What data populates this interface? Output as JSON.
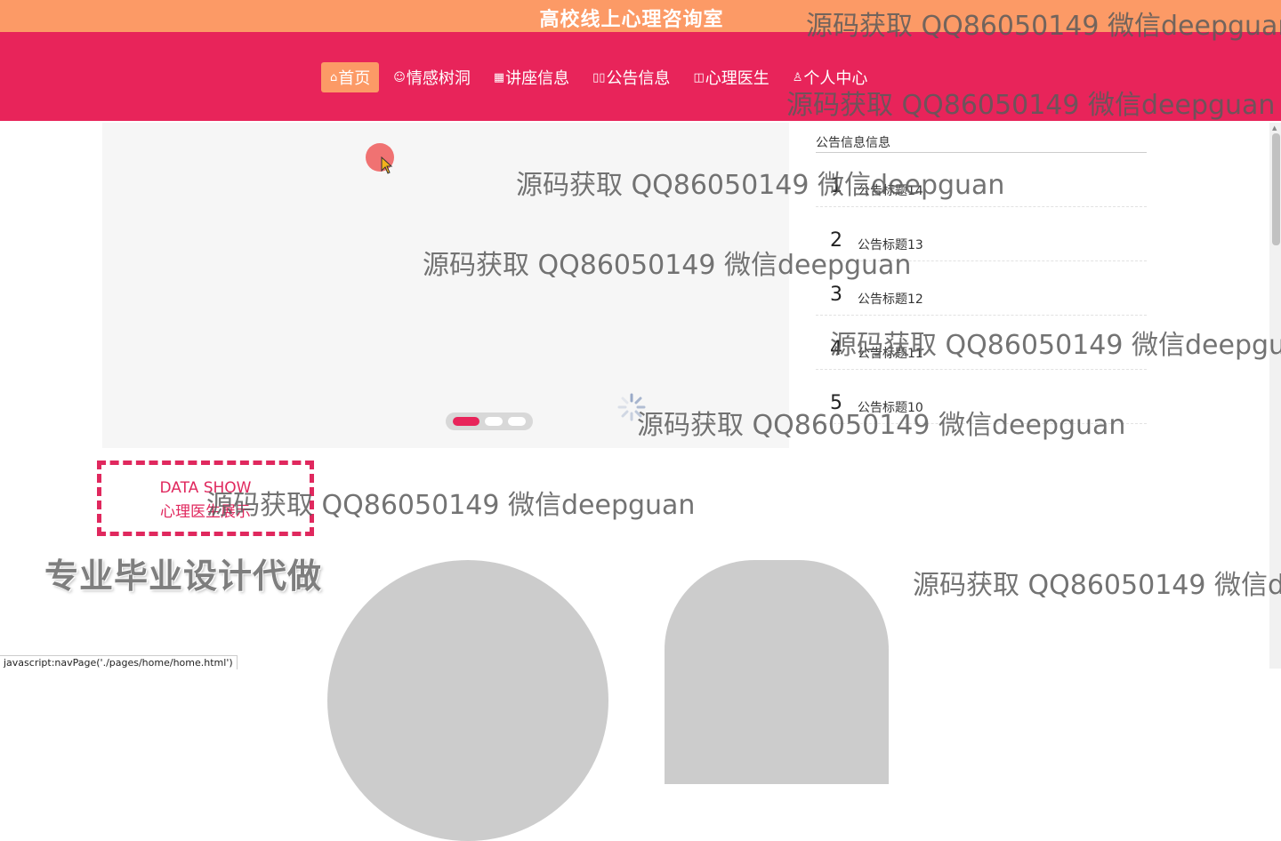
{
  "header": {
    "title": "高校线上心理咨询室"
  },
  "nav": {
    "items": [
      {
        "label": "首页",
        "icon": "home-icon",
        "active": true
      },
      {
        "label": "情感树洞",
        "icon": "smile-icon",
        "active": false
      },
      {
        "label": "讲座信息",
        "icon": "grid-icon",
        "active": false
      },
      {
        "label": "公告信息",
        "icon": "columns-icon",
        "active": false
      },
      {
        "label": "心理医生",
        "icon": "book-icon",
        "active": false
      },
      {
        "label": "个人中心",
        "icon": "user-icon",
        "active": false
      }
    ]
  },
  "carousel": {
    "total_slides": 3,
    "active_index": 0
  },
  "notices": {
    "heading": "公告信息信息",
    "items": [
      {
        "num": "1",
        "title": "公告标题14"
      },
      {
        "num": "2",
        "title": "公告标题13"
      },
      {
        "num": "3",
        "title": "公告标题12"
      },
      {
        "num": "4",
        "title": "公告标题11"
      },
      {
        "num": "5",
        "title": "公告标题10"
      }
    ]
  },
  "section": {
    "en": "DATA SHOW",
    "cn": "心理医生展示"
  },
  "promo": {
    "text": "专业毕业设计代做"
  },
  "watermark": {
    "text": "源码获取 QQ86050149 微信deepguan"
  },
  "status_bar": {
    "url": "javascript:navPage('./pages/home/home.html')"
  },
  "colors": {
    "topbar": "#fc9a66",
    "navbar": "#e8245a",
    "accent": "#e0285e"
  }
}
